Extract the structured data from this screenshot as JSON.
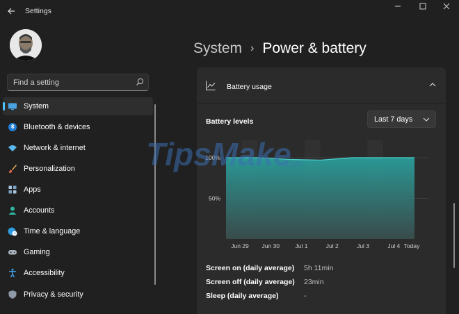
{
  "window": {
    "title": "Settings"
  },
  "search": {
    "placeholder": "Find a setting"
  },
  "nav": {
    "items": [
      {
        "label": "System",
        "icon": "monitor-icon",
        "active": true
      },
      {
        "label": "Bluetooth & devices",
        "icon": "bluetooth-icon"
      },
      {
        "label": "Network & internet",
        "icon": "wifi-icon"
      },
      {
        "label": "Personalization",
        "icon": "brush-icon"
      },
      {
        "label": "Apps",
        "icon": "apps-icon"
      },
      {
        "label": "Accounts",
        "icon": "person-icon"
      },
      {
        "label": "Time & language",
        "icon": "globe-clock-icon"
      },
      {
        "label": "Gaming",
        "icon": "gamepad-icon"
      },
      {
        "label": "Accessibility",
        "icon": "accessibility-icon"
      },
      {
        "label": "Privacy & security",
        "icon": "shield-icon"
      }
    ]
  },
  "breadcrumb": {
    "parent": "System",
    "current": "Power & battery"
  },
  "battery_usage": {
    "title": "Battery usage",
    "levels_title": "Battery levels",
    "range": "Last 7 days"
  },
  "chart_data": {
    "type": "area",
    "x": [
      "Jun 29",
      "Jun 30",
      "Jul 1",
      "Jul 2",
      "Jul 3",
      "Jul 4",
      "Today"
    ],
    "series": [
      {
        "values": [
          100,
          100,
          98,
          97,
          100,
          100,
          100
        ]
      }
    ],
    "y_ticks": [
      "100%",
      "50%"
    ],
    "ylim": [
      0,
      100
    ],
    "colors": {
      "fill_top": "#2a9d9a",
      "fill_bottom": "#3a4f4e",
      "line": "#4cd1cc"
    }
  },
  "stats": [
    {
      "label": "Screen on (daily average)",
      "value": "5h 11min"
    },
    {
      "label": "Screen off (daily average)",
      "value": "23min"
    },
    {
      "label": "Sleep (daily average)",
      "value": "-"
    }
  ],
  "watermark": {
    "brand": "TipsMake",
    "suffix": ".com"
  },
  "colors": {
    "accent": "#4cc2ff",
    "background": "#202020",
    "card": "#2b2b2b"
  }
}
